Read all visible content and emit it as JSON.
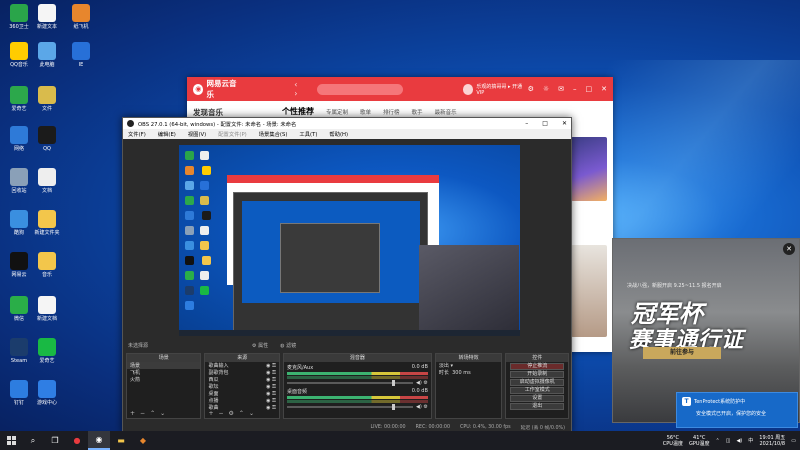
{
  "desktop": {
    "icons": [
      {
        "label": "360卫士",
        "color": "#2aa54a"
      },
      {
        "label": "新建文本",
        "color": "#f5f5f5"
      },
      {
        "label": "纸飞机",
        "color": "#e7862d"
      },
      {
        "label": "QQ音乐",
        "color": "#ffcc00"
      },
      {
        "label": "此电脑",
        "color": "#5ba7e8"
      },
      {
        "label": "IE",
        "color": "#2770d8"
      },
      {
        "label": "爱奇艺",
        "color": "#2ca84b"
      },
      {
        "label": "文件",
        "color": "#d9bb4c"
      },
      {
        "label": "网络",
        "color": "#2e7ad8"
      },
      {
        "label": "QQ",
        "color": "#1b1b1b"
      },
      {
        "label": "回收站",
        "color": "#8aa0b8"
      },
      {
        "label": "文档",
        "color": "#eeeeee"
      },
      {
        "label": "酷狗",
        "color": "#3a8fe0"
      },
      {
        "label": "新建文件夹",
        "color": "#f3c64b"
      },
      {
        "label": "网易云",
        "color": "#111111"
      },
      {
        "label": "音乐",
        "color": "#f3c64b"
      },
      {
        "label": "微信",
        "color": "#2aae48"
      },
      {
        "label": "新建文档",
        "color": "#f5f5f5"
      },
      {
        "label": "Steam",
        "color": "#1b3c6c"
      },
      {
        "label": "爱奇艺",
        "color": "#19b944"
      },
      {
        "label": "钉钉",
        "color": "#2d7de0"
      },
      {
        "label": "游戏中心",
        "color": "#2f7ee4"
      }
    ]
  },
  "netease": {
    "app_name": "网易云音乐",
    "sidebar_title": "发现音乐",
    "tabs": [
      "个性推荐",
      "专属定制",
      "歌单",
      "排行榜",
      "歌手",
      "最新音乐"
    ],
    "user": "乐观的搞哥哥 ▸ 开通VIP",
    "badge": "18"
  },
  "obs": {
    "title": "OBS 27.0.1 (64-bit, windows) - 配置文件: 未命名 - 场景: 未命名",
    "menu": [
      "文件(F)",
      "编辑(E)",
      "视图(V)",
      "配置文件(P)",
      "场景集合(S)",
      "工具(T)",
      "帮助(H)"
    ],
    "scene_bar": {
      "label": "未选择源",
      "props": "属性",
      "filters": "滤镜"
    },
    "docks": {
      "scenes": {
        "title": "场景",
        "items": [
          "场景",
          "飞机",
          "火箭"
        ]
      },
      "sources": {
        "title": "来源",
        "items": [
          "歌曲输入",
          "副歌背包",
          "西瓜",
          "歌坛",
          "桌面",
          "点播",
          "歌曲"
        ]
      },
      "mixer": {
        "title": "混音器",
        "channels": [
          {
            "name": "麦克风/Aux",
            "db": "0.0 dB"
          },
          {
            "name": "桌面音频",
            "db": "0.0 dB"
          }
        ]
      },
      "transitions": {
        "title": "转场特效",
        "type": "淡出",
        "duration_label": "时长",
        "duration": "300 ms"
      },
      "controls": {
        "title": "控件",
        "buttons": [
          "停止推流",
          "开始录制",
          "启动虚拟摄像机",
          "工作室模式",
          "设置",
          "退出"
        ]
      }
    },
    "status": {
      "live": "LIVE: 00:00:00",
      "rec": "REC: 00:00:00",
      "cpu": "CPU: 0.4%, 30.00 fps",
      "dropped": "延迟 (丢 0 帧/0.0%)"
    }
  },
  "game_ad": {
    "sub": "决战八强，新服开启 9.25~11.5 报名开启",
    "title1": "冠军杯",
    "title2": "赛事通行证",
    "button": "前往参与"
  },
  "toast": {
    "title": "TenProtect系统防护中",
    "body": "安全模式已开启，保护您的安全"
  },
  "taskbar": {
    "temps": [
      {
        "value": "56°C",
        "label": "CPU温度"
      },
      {
        "value": "41°C",
        "label": "GPU温度"
      }
    ],
    "ime": "中",
    "time": "19:01 周五",
    "date": "2021/10/8"
  }
}
